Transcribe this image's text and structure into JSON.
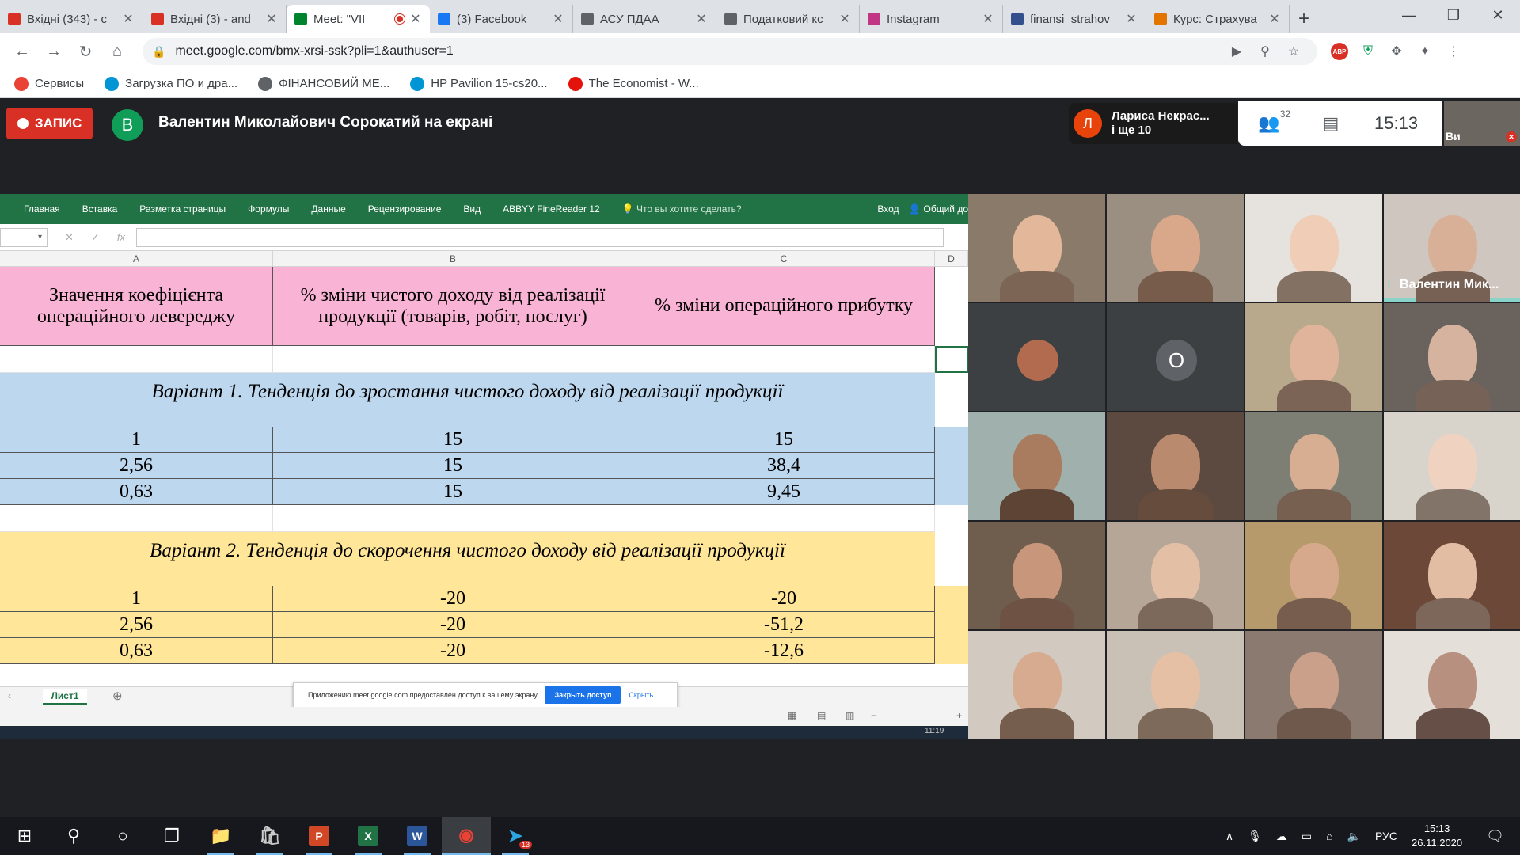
{
  "browser": {
    "tabs": [
      {
        "title": "Вхідні (343) - c",
        "favicon": "gmail-icon",
        "color": "#d93025"
      },
      {
        "title": "Вхідні (3) - and",
        "favicon": "gmail-icon",
        "color": "#d93025"
      },
      {
        "title": "Meet: \"VII",
        "favicon": "meet-icon",
        "color": "#00832d",
        "active": true,
        "recording": true
      },
      {
        "title": "(3) Facebook",
        "favicon": "facebook-icon",
        "color": "#1877f2"
      },
      {
        "title": "АСУ ПДАА",
        "favicon": "globe-icon",
        "color": "#5f6368"
      },
      {
        "title": "Податковий кс",
        "favicon": "document-icon",
        "color": "#5f6368"
      },
      {
        "title": "Instagram",
        "favicon": "instagram-icon",
        "color": "#c13584"
      },
      {
        "title": "finansi_strahov",
        "favicon": "emblem-icon",
        "color": "#34508c"
      },
      {
        "title": "Курс: Страхува",
        "favicon": "course-icon",
        "color": "#e37400"
      }
    ],
    "url": "meet.google.com/bmx-xrsi-ssk?pli=1&authuser=1",
    "bookmarks": [
      {
        "label": "Сервисы",
        "icon": "apps-grid-icon"
      },
      {
        "label": "Загрузка ПО и дра...",
        "icon": "hp-icon"
      },
      {
        "label": "ФІНАНСОВИЙ МЕ...",
        "icon": "globe-icon"
      },
      {
        "label": "HP Pavilion 15-cs20...",
        "icon": "hp-icon"
      },
      {
        "label": "The Economist - W...",
        "icon": "economist-icon"
      }
    ]
  },
  "meet": {
    "record_label": "ЗАПИС",
    "presenter_initial": "В",
    "presenter_text": "Валентин Миколайович Сорокатий на екрані",
    "speaker_initial": "Л",
    "speaker_name": "Лариса Некрас...",
    "speaker_more": "і ще 10",
    "participants_count": "32",
    "time": "15:13",
    "self_label": "Ви",
    "tiles": [
      {
        "name": "",
        "bg": "#8a7a6a",
        "skin": "#e2b79a"
      },
      {
        "name": "",
        "bg": "#9b8f82",
        "skin": "#d9a88a"
      },
      {
        "name": "",
        "bg": "#e6e3df",
        "skin": "#efcdb6"
      },
      {
        "name": "Валентин Мик...",
        "bg": "#cfc7bf",
        "skin": "#d8b098",
        "highlight": true
      },
      {
        "name": "",
        "bg": "#3c4043",
        "avatar_initial": "",
        "avatar_color": "#b36b4f"
      },
      {
        "name": "",
        "bg": "#3c4043",
        "avatar_initial": "O",
        "avatar_color": "#5f6368"
      },
      {
        "name": "",
        "bg": "#b8a88c",
        "skin": "#e0b49a"
      },
      {
        "name": "",
        "bg": "#6a625c",
        "skin": "#d6b39e"
      },
      {
        "name": "",
        "bg": "#9fb0ad",
        "skin": "#a97c60"
      },
      {
        "name": "",
        "bg": "#5c4a40",
        "skin": "#b98a6e"
      },
      {
        "name": "",
        "bg": "#7d7f74",
        "skin": "#d8ae92"
      },
      {
        "name": "",
        "bg": "#d8d4cc",
        "skin": "#efd2c0"
      },
      {
        "name": "",
        "bg": "#6f5d4d",
        "skin": "#c8967a"
      },
      {
        "name": "",
        "bg": "#b5a697",
        "skin": "#e3bfa6"
      },
      {
        "name": "",
        "bg": "#b79a6c",
        "skin": "#d6a98c"
      },
      {
        "name": "",
        "bg": "#6c4838",
        "skin": "#e2bca3"
      },
      {
        "name": "",
        "bg": "#d2cac0",
        "skin": "#d7ab90"
      },
      {
        "name": "",
        "bg": "#c9c1b5",
        "skin": "#e5c0a4"
      },
      {
        "name": "",
        "bg": "#8a7a70",
        "skin": "#caa08a"
      },
      {
        "name": "",
        "bg": "#e4dfd8",
        "skin": "#b89080"
      }
    ]
  },
  "excel": {
    "ribbon_tabs": [
      "Главная",
      "Вставка",
      "Разметка страницы",
      "Формулы",
      "Данные",
      "Рецензирование",
      "Вид",
      "ABBYY FineReader 12"
    ],
    "ask": "Что вы хотите сделать?",
    "login": "Вход",
    "share": "Общий до",
    "columns": [
      "A",
      "B",
      "C",
      "D"
    ],
    "header": [
      "Значення коефіцієнта операційного левереджу",
      "% зміни чистого доходу від реалізації продукції (товарів, робіт, послуг)",
      "% зміни операційного прибутку"
    ],
    "variant1_title": "Варіант 1. Тенденція до зростання чистого доходу від реалізації продукції",
    "variant1_rows": [
      [
        "1",
        "15",
        "15"
      ],
      [
        "2,56",
        "15",
        "38,4"
      ],
      [
        "0,63",
        "15",
        "9,45"
      ]
    ],
    "variant2_title": "Варіант 2. Тенденція до скорочення чистого доходу від реалізації продукції",
    "variant2_rows": [
      [
        "1",
        "-20",
        "-20"
      ],
      [
        "2,56",
        "-20",
        "-51,2"
      ],
      [
        "0,63",
        "-20",
        "-12,6"
      ]
    ],
    "sheet_name": "Лист1",
    "notice_text": "Приложению meet.google.com предоставлен доступ к вашему экрану.",
    "notice_stop": "Закрыть доступ",
    "notice_hide": "Скрыть",
    "inner_clock": "11:19"
  },
  "taskbar": {
    "apps": [
      {
        "name": "windows-start-icon",
        "glyph": "⊞"
      },
      {
        "name": "search-icon",
        "glyph": "⚲"
      },
      {
        "name": "cortana-icon",
        "glyph": "○"
      },
      {
        "name": "task-view-icon",
        "glyph": "❐"
      },
      {
        "name": "file-explorer-icon",
        "glyph": "📁",
        "color": "#f2c94c"
      },
      {
        "name": "store-icon",
        "glyph": "🛍",
        "color": "#cccccc"
      },
      {
        "name": "powerpoint-icon",
        "glyph": "P",
        "color": "#d24726"
      },
      {
        "name": "excel-icon",
        "glyph": "X",
        "color": "#217346"
      },
      {
        "name": "word-icon",
        "glyph": "W",
        "color": "#2b579a"
      },
      {
        "name": "chrome-icon",
        "glyph": "◉",
        "color": "#ea4335",
        "active": true
      },
      {
        "name": "telegram-icon",
        "glyph": "➤",
        "color": "#2ca5e0",
        "badge": "13"
      }
    ],
    "language": "РУС",
    "time": "15:13",
    "date": "26.11.2020"
  }
}
